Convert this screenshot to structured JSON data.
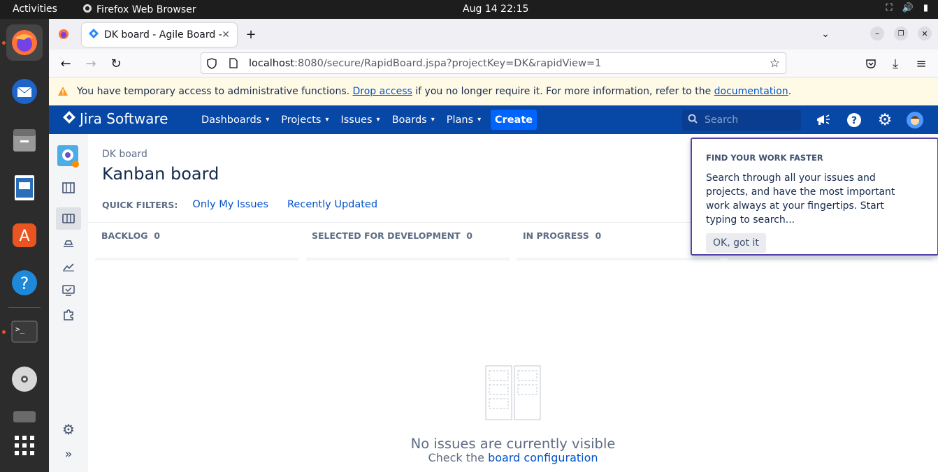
{
  "os": {
    "activities": "Activities",
    "app_name": "Firefox Web Browser",
    "clock": "Aug 14  22:15"
  },
  "browser": {
    "tab_title": "DK board - Agile Board - J",
    "url_host": "localhost",
    "url_path": ":8080/secure/RapidBoard.jspa?projectKey=DK&rapidView=1"
  },
  "banner": {
    "text_before": "You have temporary access to administrative functions. ",
    "drop_link": "Drop access",
    "text_middle": " if you no longer require it. For more information, refer to the ",
    "doc_link": "documentation",
    "text_after": "."
  },
  "jira_nav": {
    "logo": "Jira Software",
    "menu": [
      "Dashboards",
      "Projects",
      "Issues",
      "Boards",
      "Plans"
    ],
    "create": "Create",
    "search_placeholder": "Search"
  },
  "board": {
    "breadcrumb": "DK board",
    "title": "Kanban board",
    "quick_filters_label": "QUICK FILTERS:",
    "filters": [
      "Only My Issues",
      "Recently Updated"
    ],
    "columns": [
      {
        "name": "BACKLOG",
        "count": "0"
      },
      {
        "name": "SELECTED FOR DEVELOPMENT",
        "count": "0"
      },
      {
        "name": "IN PROGRESS",
        "count": "0"
      }
    ],
    "empty_title": "No issues are currently visible",
    "empty_sub": "Check the ",
    "empty_link": "board configuration"
  },
  "popup": {
    "heading": "FIND YOUR WORK FASTER",
    "body": "Search through all your issues and projects, and have the most important work always at your fingertips. Start typing to search...",
    "button": "OK, got it"
  },
  "colors": {
    "jira_nav": "#0747a6",
    "create_button": "#0065ff",
    "popup_border": "#5243aa",
    "banner_bg": "#fffae6",
    "link": "#0052cc"
  }
}
